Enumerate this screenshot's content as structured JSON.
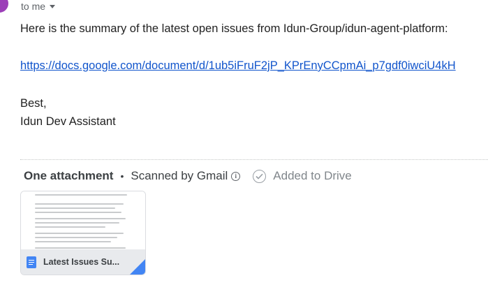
{
  "header": {
    "recipient_label": "to me"
  },
  "message": {
    "intro": "Here is the summary of the latest open issues from Idun-Group/idun-agent-platform:",
    "link": "https://docs.google.com/document/d/1ub5iFruF2jP_KPrEnyCCpmAi_p7gdf0iwciU4kH",
    "signoff": "Best,",
    "signature": "Idun Dev Assistant"
  },
  "attachments": {
    "count_label": "One attachment",
    "separator": "•",
    "scanned_label": "Scanned by Gmail",
    "info_glyph": "i",
    "added_label": "Added to Drive",
    "file": {
      "name": "Latest Issues Su...",
      "icon": "google-docs-icon",
      "icon_color": "#4285f4"
    }
  },
  "colors": {
    "link": "#1155cc",
    "avatar": "#9c3fb8",
    "doc_blue": "#4285f4"
  }
}
